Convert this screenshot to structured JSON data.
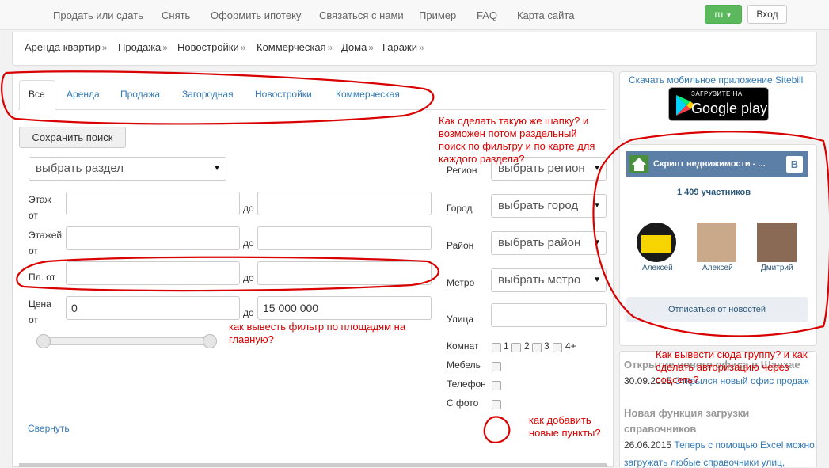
{
  "topnav": {
    "items": [
      "Продать или сдать",
      "Снять",
      "Оформить ипотеку",
      "Связаться с нами",
      "Пример",
      "FAQ",
      "Карта сайта"
    ],
    "lang": "ru",
    "login": "Вход"
  },
  "categories": [
    "Аренда квартир",
    "Продажа",
    "Новостройки",
    "Коммерческая",
    "Дома",
    "Гаражи"
  ],
  "category_arrow": "»",
  "tabs": [
    "Все",
    "Аренда",
    "Продажа",
    "Загородная",
    "Новостройки",
    "Коммерческая"
  ],
  "search": {
    "save_label": "Сохранить поиск",
    "section_select": "выбрать раздел",
    "floor_label_1": "Этаж",
    "floor_label_2": "от",
    "floors_label_1": "Этажей",
    "floors_label_2": "от",
    "area_label": "Пл. от",
    "price_label_1": "Цена",
    "price_label_2": "от",
    "to_label": "до",
    "price_from": "0",
    "price_to": "15 000 000",
    "region_label": "Регион",
    "region_select": "выбрать регион",
    "city_label": "Город",
    "city_select": "выбрать город",
    "district_label": "Район",
    "district_select": "выбрать район",
    "metro_label": "Метро",
    "metro_select": "выбрать метро",
    "street_label": "Улица",
    "rooms_label": "Комнат",
    "rooms": [
      "1",
      "2",
      "3",
      "4+"
    ],
    "furniture_label": "Мебель",
    "phone_label": "Телефон",
    "photo_label": "С фото",
    "collapse": "Свернуть"
  },
  "sidebar": {
    "app_link": "Скачать мобильное приложение Sitebill",
    "gp_small": "ЗАГРУЗИТЕ НА",
    "gp_big": "Google play",
    "vk_title": "Скрипт недвижимости - ...",
    "vk_members": "1 409 участников",
    "vk_users": [
      "Алексей",
      "Алексей",
      "Дмитрий"
    ],
    "vk_unsubscribe": "Отписаться от новостей",
    "news": [
      {
        "title": "Открытие нового офиса в Шанхае",
        "date": "30.09.2015",
        "text": "Открылся новый офис продаж"
      },
      {
        "title": "Новая функция загрузки справочников",
        "date": "26.06.2015",
        "text": "Теперь с помощью Excel можно",
        "text2": "загружать любые справочники улиц,"
      }
    ]
  },
  "annotations": {
    "header_question": "Как сделать такую же шапку? и возможен потом раздельный поиск по фильтру и по карте для каждого раздела?",
    "area_question": "как вывесть фильтр по площадям на главную?",
    "add_items_question": "как добавить новые пункты?",
    "group_question": "Как вывести сюда группу? и как сделать авторизацию через соцсеть?"
  },
  "colors": {
    "link": "#337ab7",
    "annotation": "#d90000",
    "lang_button": "#5cb85c",
    "vk_header": "#5b7fa6"
  }
}
